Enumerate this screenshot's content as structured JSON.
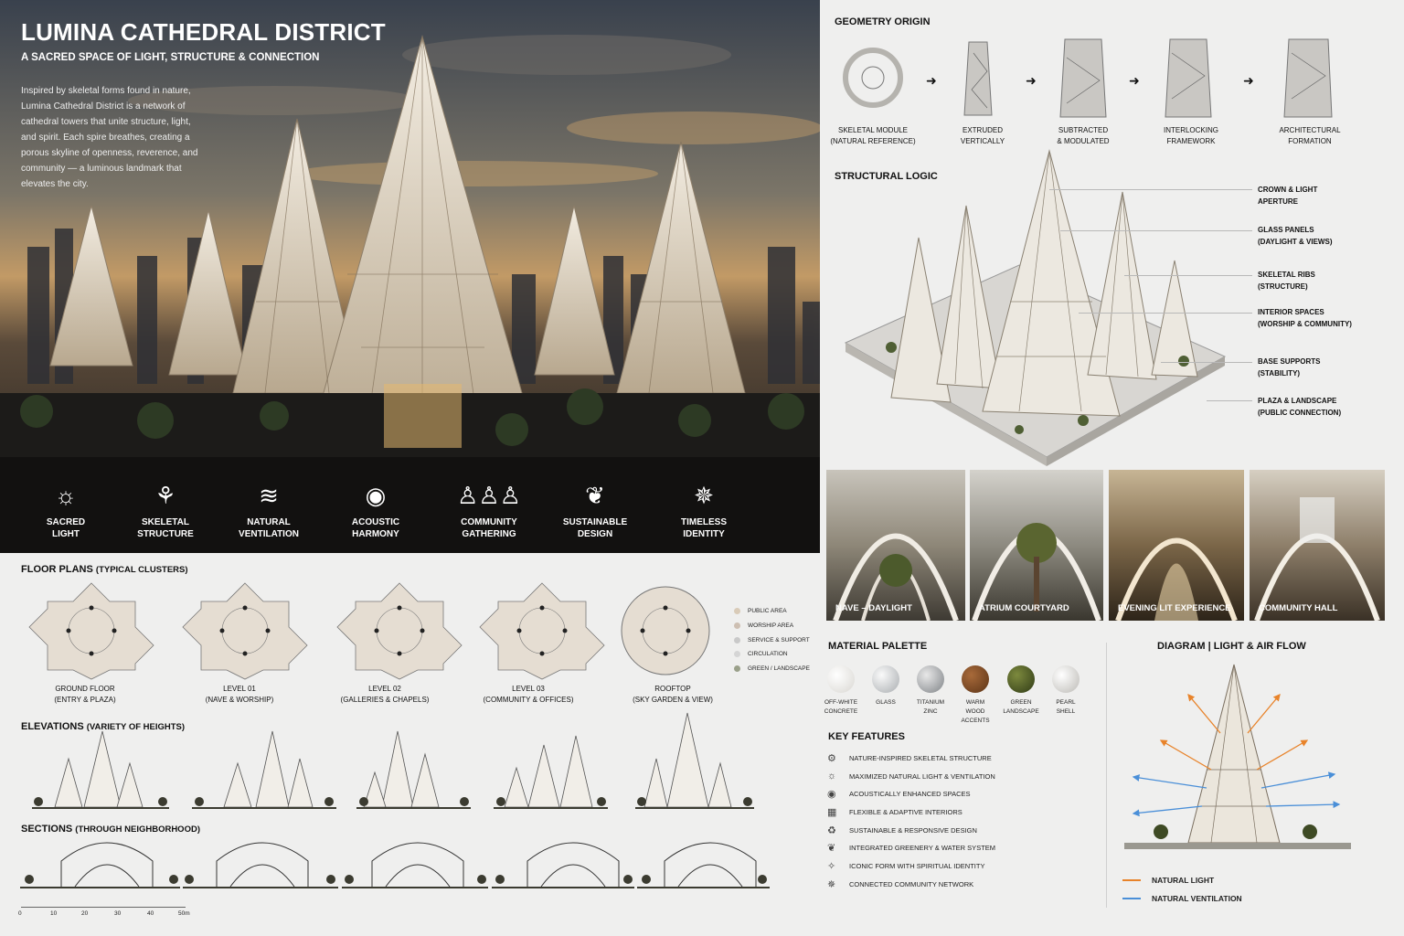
{
  "hero": {
    "title": "LUMINA CATHEDRAL DISTRICT",
    "subtitle": "A SACRED SPACE OF LIGHT, STRUCTURE & CONNECTION",
    "description": "Inspired by skeletal forms found in nature, Lumina Cathedral District is a network of cathedral towers that unite structure, light, and spirit. Each spire breathes, creating a porous skyline of openness, reverence, and community — a luminous landmark that elevates the city.",
    "features": [
      {
        "icon": "sun-icon",
        "label": "SACRED\nLIGHT"
      },
      {
        "icon": "branch-icon",
        "label": "SKELETAL\nSTRUCTURE"
      },
      {
        "icon": "wind-icon",
        "label": "NATURAL\nVENTILATION"
      },
      {
        "icon": "sound-waves-icon",
        "label": "ACOUSTIC\nHARMONY"
      },
      {
        "icon": "people-icon",
        "label": "COMMUNITY\nGATHERING"
      },
      {
        "icon": "leaf-icon",
        "label": "SUSTAINABLE\nDESIGN"
      },
      {
        "icon": "polyhedron-icon",
        "label": "TIMELESS\nIDENTITY"
      }
    ]
  },
  "geometry": {
    "title": "GEOMETRY ORIGIN",
    "steps": [
      "SKELETAL MODULE\n(NATURAL REFERENCE)",
      "EXTRUDED\nVERTICALLY",
      "SUBTRACTED\n& MODULATED",
      "INTERLOCKING\nFRAMEWORK",
      "ARCHITECTURAL\nFORMATION"
    ]
  },
  "structural": {
    "title": "STRUCTURAL LOGIC",
    "labels": [
      "CROWN & LIGHT\nAPERTURE",
      "GLASS PANELS\n(DAYLIGHT & VIEWS)",
      "SKELETAL RIBS\n(STRUCTURE)",
      "INTERIOR SPACES\n(WORSHIP & COMMUNITY)",
      "BASE SUPPORTS\n(STABILITY)",
      "PLAZA & LANDSCAPE\n(PUBLIC CONNECTION)"
    ]
  },
  "photos": [
    "NAVE – DAYLIGHT",
    "ATRIUM COURTYARD",
    "EVENING LIT EXPERIENCE",
    "COMMUNITY HALL"
  ],
  "floor_plans": {
    "title": "FLOOR PLANS",
    "title_note": "(TYPICAL CLUSTERS)",
    "plans": [
      "GROUND FLOOR\n(ENTRY & PLAZA)",
      "LEVEL 01\n(NAVE & WORSHIP)",
      "LEVEL 02\n(GALLERIES & CHAPELS)",
      "LEVEL 03\n(COMMUNITY & OFFICES)",
      "ROOFTOP\n(SKY GARDEN & VIEW)"
    ],
    "legend": [
      {
        "label": "PUBLIC AREA",
        "color": "#d9cbb8"
      },
      {
        "label": "WORSHIP AREA",
        "color": "#cdbfb2"
      },
      {
        "label": "SERVICE & SUPPORT",
        "color": "#c9c9c9"
      },
      {
        "label": "CIRCULATION",
        "color": "#d5d5d5"
      },
      {
        "label": "GREEN / LANDSCAPE",
        "color": "#9aa08a"
      }
    ]
  },
  "elevations": {
    "title": "ELEVATIONS",
    "title_note": "(VARIETY OF HEIGHTS)"
  },
  "sections": {
    "title": "SECTIONS",
    "title_note": "(THROUGH NEIGHBORHOOD)"
  },
  "scale": [
    "0",
    "10",
    "20",
    "30",
    "40",
    "50m"
  ],
  "materials": {
    "title": "MATERIAL PALETTE",
    "items": [
      {
        "label": "OFF-WHITE\nCONCRETE",
        "color": "#e8e6e2"
      },
      {
        "label": "GLASS",
        "color": "#cfd2d4"
      },
      {
        "label": "TITANIUM\nZINC",
        "color": "#9ea2a6"
      },
      {
        "label": "WARM WOOD\nACCENTS",
        "color": "#7a4a26"
      },
      {
        "label": "GREEN\nLANDSCAPE",
        "color": "#4e5a2a"
      },
      {
        "label": "PEARL\nSHELL",
        "color": "#dcdad6"
      }
    ]
  },
  "key_features": {
    "title": "KEY FEATURES",
    "items": [
      "NATURE-INSPIRED SKELETAL STRUCTURE",
      "MAXIMIZED NATURAL LIGHT & VENTILATION",
      "ACOUSTICALLY ENHANCED SPACES",
      "FLEXIBLE & ADAPTIVE INTERIORS",
      "SUSTAINABLE & RESPONSIVE DESIGN",
      "INTEGRATED GREENERY & WATER SYSTEM",
      "ICONIC FORM WITH SPIRITUAL IDENTITY",
      "CONNECTED COMMUNITY NETWORK"
    ]
  },
  "diagram": {
    "title": "DIAGRAM | LIGHT & AIR FLOW",
    "legend_light": "NATURAL LIGHT",
    "legend_vent": "NATURAL VENTILATION",
    "light_color": "#e8832a",
    "vent_color": "#4a8fd8"
  }
}
